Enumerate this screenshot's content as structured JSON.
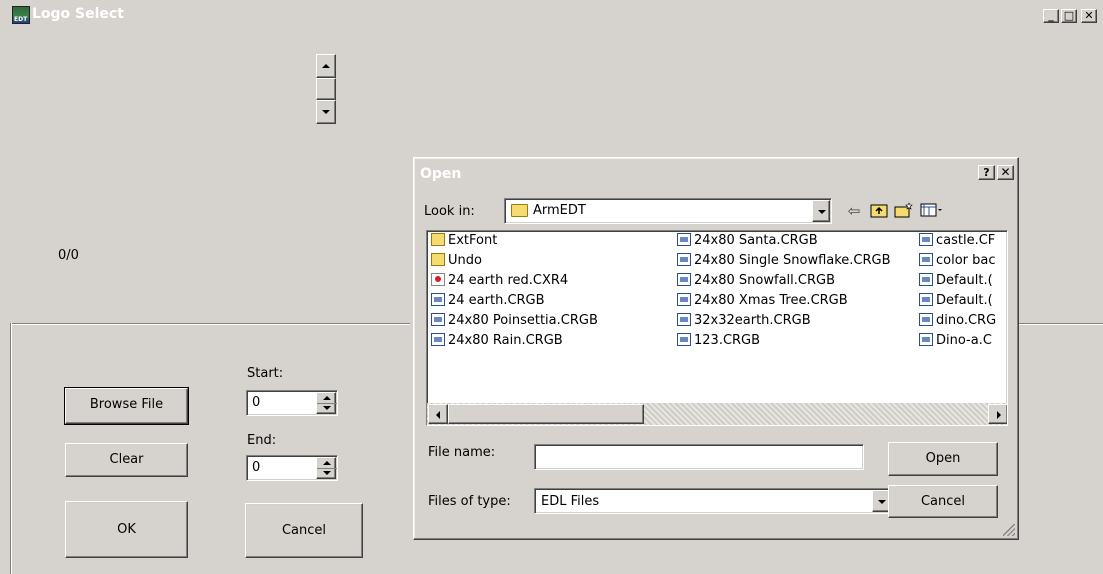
{
  "window": {
    "title": "Logo Select",
    "icon_label": "EDT",
    "minimize": "_",
    "maximize": "□",
    "close": "✕"
  },
  "main": {
    "counter": "0/0",
    "start_label": "Start:",
    "start_value": "0",
    "end_label": "End:",
    "end_value": "0",
    "browse_label": "Browse File",
    "clear_label": "Clear",
    "ok_label": "OK",
    "cancel_label": "Cancel"
  },
  "open_dialog": {
    "title": "Open",
    "help": "?",
    "close": "✕",
    "look_in_label": "Look in:",
    "look_in_value": "ArmEDT",
    "toolbar_icons": [
      "back-arrow-icon",
      "up-folder-icon",
      "new-folder-icon",
      "views-menu-icon"
    ],
    "files": [
      {
        "name": "ExtFont",
        "type": "folder"
      },
      {
        "name": "Undo",
        "type": "folder"
      },
      {
        "name": "24 earth red.CXR4",
        "type": "red"
      },
      {
        "name": "24 earth.CRGB",
        "type": "file"
      },
      {
        "name": "24x80 Poinsettia.CRGB",
        "type": "file"
      },
      {
        "name": "24x80 Rain.CRGB",
        "type": "file"
      },
      {
        "name": "24x80 Santa.CRGB",
        "type": "file"
      },
      {
        "name": "24x80 Single Snowflake.CRGB",
        "type": "file"
      },
      {
        "name": "24x80 Snowfall.CRGB",
        "type": "file"
      },
      {
        "name": "24x80 Xmas Tree.CRGB",
        "type": "file"
      },
      {
        "name": "32x32earth.CRGB",
        "type": "file"
      },
      {
        "name": "123.CRGB",
        "type": "file"
      },
      {
        "name": "castle.CF",
        "type": "file"
      },
      {
        "name": "color bac",
        "type": "file"
      },
      {
        "name": "Default.(",
        "type": "file"
      },
      {
        "name": "Default.(",
        "type": "file"
      },
      {
        "name": "dino.CRG",
        "type": "file"
      },
      {
        "name": "Dino-a.C",
        "type": "file"
      }
    ],
    "file_name_label": "File name:",
    "file_name_value": "",
    "files_of_type_label": "Files of type:",
    "files_of_type_value": "EDL Files",
    "open_label": "Open",
    "cancel_label": "Cancel"
  },
  "colors": {
    "face": "#d6d3ce",
    "title_text": "#ffffff",
    "folder": "#f5dc6e"
  }
}
